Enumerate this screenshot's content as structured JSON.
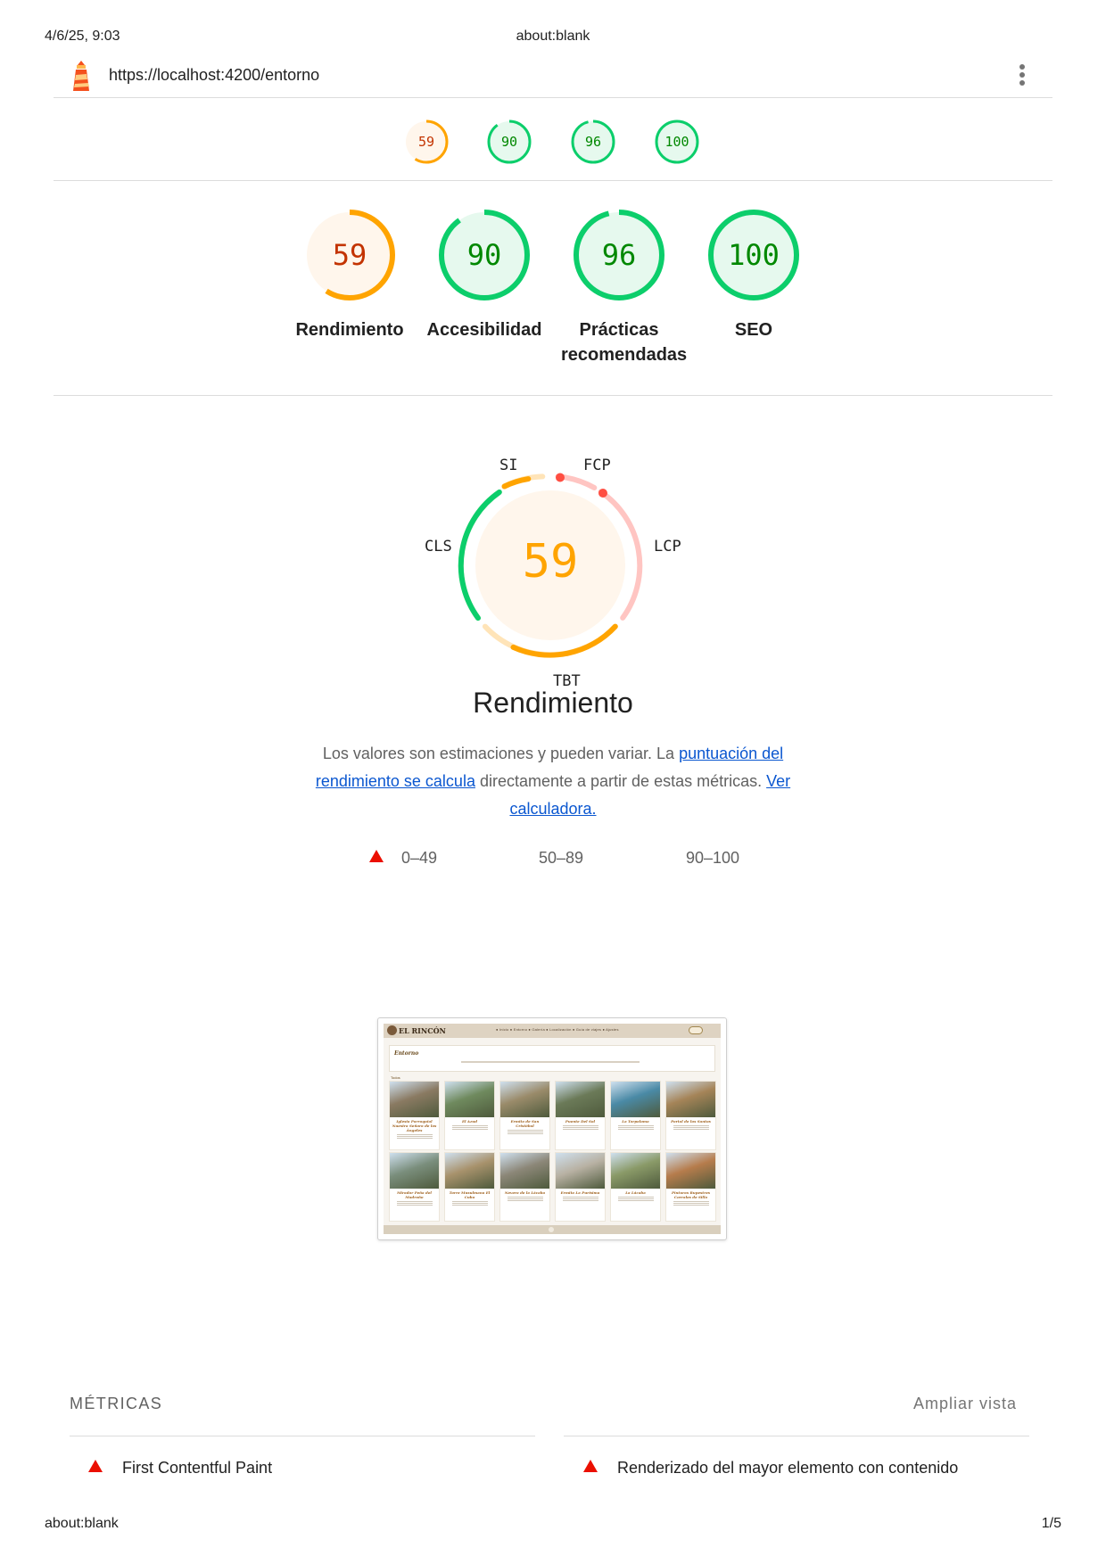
{
  "print": {
    "date": "4/6/25, 9:03",
    "title": "about:blank",
    "footer_left": "about:blank",
    "footer_right": "1/5"
  },
  "topbar": {
    "url": "https://localhost:4200/entorno",
    "logo_icon": "lighthouse-icon",
    "menu_icon": "kebab-menu-icon"
  },
  "scores": [
    {
      "value": "59",
      "label": "Rendimiento",
      "fraction": 0.59,
      "status": "average"
    },
    {
      "value": "90",
      "label": "Accesibilidad",
      "fraction": 0.9,
      "status": "pass"
    },
    {
      "value": "96",
      "label": "Prácticas recomendadas",
      "fraction": 0.96,
      "status": "pass"
    },
    {
      "value": "100",
      "label": "SEO",
      "fraction": 1.0,
      "status": "pass"
    }
  ],
  "colors": {
    "pass": "#0cce6b",
    "pass_fill": "#e6f9ee",
    "pass_text": "#008800",
    "average": "#ffa400",
    "average_fill": "#fff6ec",
    "average_text": "#c33300",
    "fail": "#ff4e42",
    "fail_light": "#ffc5c2",
    "average_light": "#ffe4b8",
    "link": "#0b57d0"
  },
  "performance": {
    "score": "59",
    "title": "Rendimiento",
    "metrics": {
      "fcp": "FCP",
      "lcp": "LCP",
      "tbt": "TBT",
      "cls": "CLS",
      "si": "SI"
    },
    "description": {
      "text1": "Los valores son estimaciones y pueden variar. La ",
      "link1": "puntuación del rendimiento se calcula",
      "text2": " directamente a partir de estas métricas. ",
      "link2": "Ver calculadora."
    },
    "legend": {
      "fail": "0–49",
      "average": "50–89",
      "pass": "90–100"
    }
  },
  "screenshot": {
    "logo": "EL RINCÓN",
    "nav": "● Inicio   ● Entorno   ● Galería   ● Localización   ● Guía de viajes   ● Ajustes",
    "section_title": "Entorno",
    "subheading": "Todos",
    "cards": [
      {
        "title": "Iglesia Parroquial Nuestra Señora de los Ángeles",
        "color": "#8a7a62"
      },
      {
        "title": "El Azud",
        "color": "#6f8a5e"
      },
      {
        "title": "Ermita de San Cristóbal",
        "color": "#9a8b6a"
      },
      {
        "title": "Puente Del Sol",
        "color": "#6b7a58"
      },
      {
        "title": "La Tarpaloma",
        "color": "#4a8aa6"
      },
      {
        "title": "Portal de los Santos",
        "color": "#a58458"
      },
      {
        "title": "Mirador Peña del Madroño",
        "color": "#7a8e7c"
      },
      {
        "title": "Torre Musulmana El Cubo",
        "color": "#a8926c"
      },
      {
        "title": "Nevero de la Lácaba",
        "color": "#8c8778"
      },
      {
        "title": "Ermita La Purísima",
        "color": "#b8b1a3"
      },
      {
        "title": "La Lácaba",
        "color": "#8a9a68"
      },
      {
        "title": "Pinturas Rupestres Corrales de Silla",
        "color": "#b67c4c"
      }
    ]
  },
  "metrics_section": {
    "title": "MÉTRICAS",
    "expand": "Ampliar vista",
    "items": [
      {
        "label": "First Contentful Paint",
        "status": "fail"
      },
      {
        "label": "Renderizado del mayor elemento con contenido",
        "status": "fail"
      }
    ]
  }
}
